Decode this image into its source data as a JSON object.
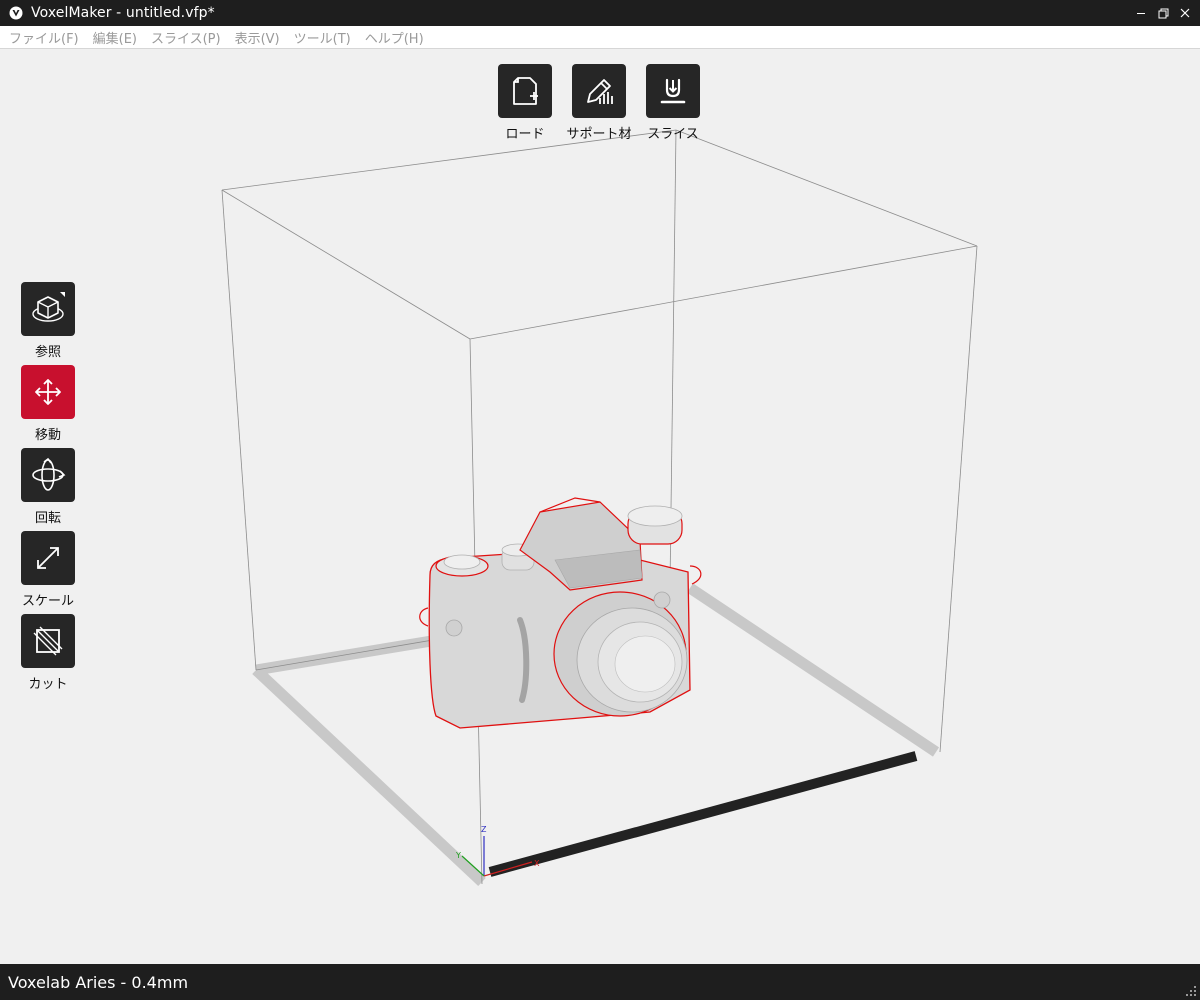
{
  "window": {
    "title": "VoxelMaker - untitled.vfp*"
  },
  "menu": [
    {
      "label": "ファイル(F)"
    },
    {
      "label": "編集(E)"
    },
    {
      "label": "スライス(P)"
    },
    {
      "label": "表示(V)"
    },
    {
      "label": "ツール(T)"
    },
    {
      "label": "ヘルプ(H)"
    }
  ],
  "top_toolbar": {
    "load": {
      "label": "ロード",
      "icon": "file-add-icon"
    },
    "support": {
      "label": "サポート材",
      "icon": "pencil-support-icon"
    },
    "slice": {
      "label": "スライス",
      "icon": "slice-download-icon"
    }
  },
  "left_toolbar": {
    "view": {
      "label": "参照",
      "icon": "cube-view-icon"
    },
    "move": {
      "label": "移動",
      "icon": "move-arrows-icon",
      "active": true
    },
    "rotate": {
      "label": "回転",
      "icon": "rotate-icon"
    },
    "scale": {
      "label": "スケール",
      "icon": "scale-icon"
    },
    "cut": {
      "label": "カット",
      "icon": "cut-icon"
    }
  },
  "axes": {
    "z": "Z",
    "y": "Y",
    "x": "X"
  },
  "status": {
    "printer": "Voxelab Aries - 0.4mm"
  },
  "colors": {
    "active_tool": "#c8102e",
    "tool_bg": "#262626",
    "titlebar": "#1e1e1e",
    "model_outline": "#e01010"
  }
}
